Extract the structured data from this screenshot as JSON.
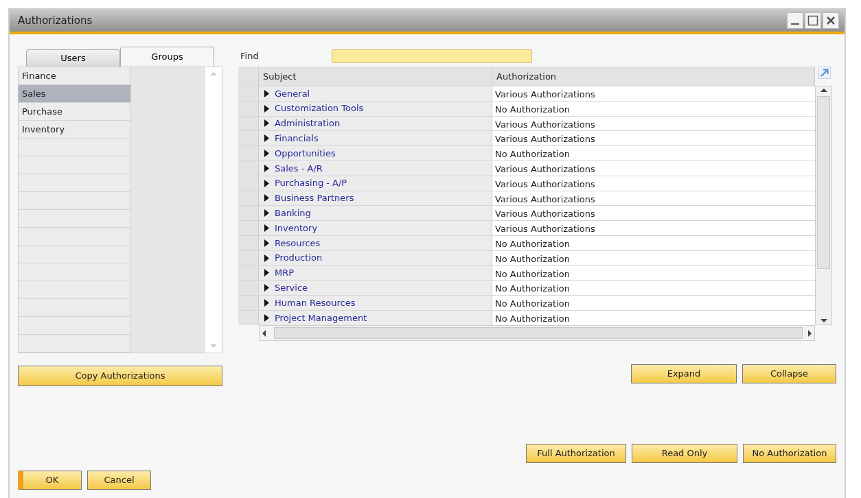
{
  "window": {
    "title": "Authorizations"
  },
  "tabs": [
    {
      "label": "Users",
      "selected": false
    },
    {
      "label": "Groups",
      "selected": true
    }
  ],
  "groups": [
    {
      "label": "Finance",
      "selected": false
    },
    {
      "label": "Sales",
      "selected": true
    },
    {
      "label": "Purchase",
      "selected": false
    },
    {
      "label": "Inventory",
      "selected": false
    }
  ],
  "copy_button": "Copy Authorizations",
  "find": {
    "label": "Find"
  },
  "table": {
    "columns": [
      "Subject",
      "Authorization"
    ],
    "rows": [
      {
        "subject": "General",
        "authorization": "Various Authorizations",
        "expanded": false
      },
      {
        "subject": "Customization Tools",
        "authorization": "No Authorization",
        "expanded": false
      },
      {
        "subject": "Administration",
        "authorization": "Various Authorizations",
        "expanded": false
      },
      {
        "subject": "Financials",
        "authorization": "Various Authorizations",
        "expanded": false
      },
      {
        "subject": "Opportunities",
        "authorization": "No Authorization",
        "expanded": false
      },
      {
        "subject": "Sales - A/R",
        "authorization": "Various Authorizations",
        "expanded": false
      },
      {
        "subject": "Purchasing - A/P",
        "authorization": "Various Authorizations",
        "expanded": false
      },
      {
        "subject": "Business Partners",
        "authorization": "Various Authorizations",
        "expanded": false
      },
      {
        "subject": "Banking",
        "authorization": "Various Authorizations",
        "expanded": false
      },
      {
        "subject": "Inventory",
        "authorization": "Various Authorizations",
        "expanded": false
      },
      {
        "subject": "Resources",
        "authorization": "No Authorization",
        "expanded": false
      },
      {
        "subject": "Production",
        "authorization": "No Authorization",
        "expanded": false
      },
      {
        "subject": "MRP",
        "authorization": "No Authorization",
        "expanded": false
      },
      {
        "subject": "Service",
        "authorization": "No Authorization",
        "expanded": false
      },
      {
        "subject": "Human Resources",
        "authorization": "No Authorization",
        "expanded": false
      },
      {
        "subject": "Project Management",
        "authorization": "No Authorization",
        "expanded": false
      }
    ]
  },
  "tree_buttons": [
    "Expand",
    "Collapse"
  ],
  "level_buttons": [
    "Full Authorization",
    "Read Only",
    "No Authorization"
  ],
  "footer_buttons": [
    {
      "label": "OK",
      "default": true
    },
    {
      "label": "Cancel",
      "default": false
    }
  ]
}
